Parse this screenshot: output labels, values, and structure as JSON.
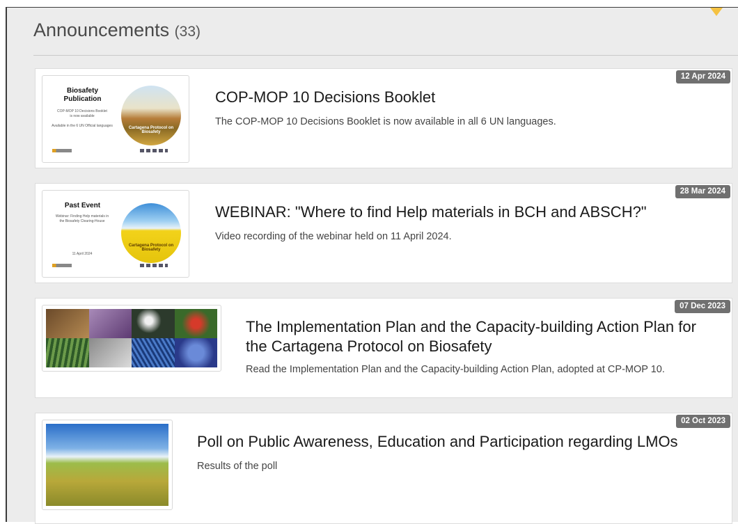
{
  "section": {
    "title": "Announcements",
    "count": "(33)"
  },
  "announcements": [
    {
      "date": "12 Apr 2024",
      "title": "COP-MOP 10 Decisions Booklet",
      "description": "The COP-MOP 10 Decisions Booklet is now available in all 6 UN languages.",
      "thumb": {
        "heading": "Biosafety Publication",
        "line1": "COP-MOP 10 Decisions Booklet",
        "line2": "is now available",
        "line3": "Available in the 6 UN Official languages",
        "circle_text": "Cartagena Protocol on Biosafety"
      }
    },
    {
      "date": "28 Mar 2024",
      "title": "WEBINAR: \"Where to find Help materials in BCH and ABSCH?\"",
      "description": "Video recording of the webinar held on 11 April 2024.",
      "thumb": {
        "heading": "Past Event",
        "line1": "Webinar: Finding Help materials in",
        "line2": "the Biosafety Clearing-House",
        "line3": "11 April 2024",
        "circle_text": "Cartagena Protocol on Biosafety"
      }
    },
    {
      "date": "07 Dec 2023",
      "title": "The Implementation Plan and the Capacity-building Action Plan for the Cartagena Protocol on Biosafety",
      "description": "Read the Implementation Plan and the Capacity-building Action Plan, adopted at CP-MOP 10."
    },
    {
      "date": "02 Oct 2023",
      "title": "Poll on Public Awareness, Education and Participation regarding LMOs",
      "description": "Results of the poll"
    }
  ],
  "colors": {
    "panel_bg": "#ececec",
    "badge_bg": "#707070",
    "accent_arrow": "#f5c242"
  }
}
